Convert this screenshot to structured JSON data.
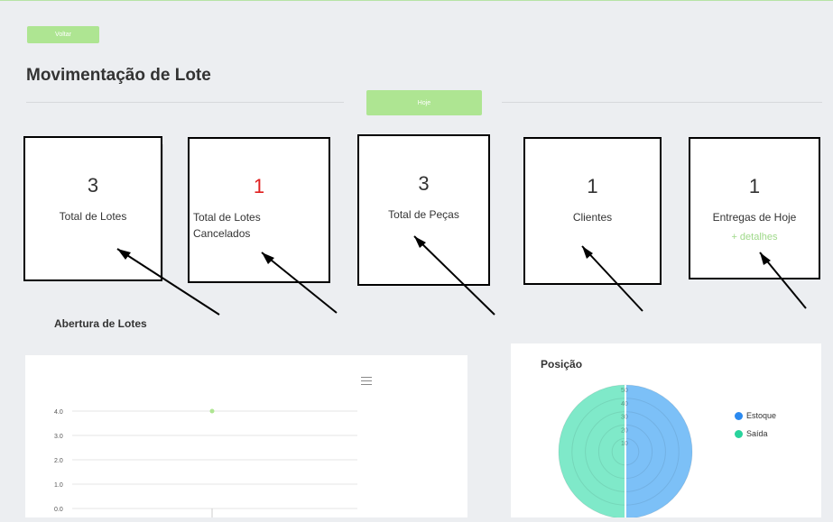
{
  "header": {
    "back_label": "Voltar",
    "title": "Movimentação de Lote",
    "today_label": "Hoje"
  },
  "cards": [
    {
      "value": "3",
      "label": "Total de Lotes"
    },
    {
      "value": "1",
      "label_line1": "Total de Lotes",
      "label_line2": "Cancelados",
      "value_color": "#e02020"
    },
    {
      "value": "3",
      "label": "Total de Peças"
    },
    {
      "value": "1",
      "label": "Clientes"
    },
    {
      "value": "1",
      "label": "Entregas de Hoje",
      "link": "+ detalhes"
    }
  ],
  "sections": {
    "lotes_title": "Abertura de Lotes"
  },
  "colors": {
    "accent_green": "#aee592",
    "estoque": "#7cc0f7",
    "saida": "#7fe9c9"
  },
  "chart_data": [
    {
      "type": "line",
      "title": "",
      "yticks": [
        "4.0",
        "3.0",
        "2.0",
        "1.0",
        "0.0"
      ],
      "ylim": [
        0,
        4
      ],
      "series": [
        {
          "values": [
            4
          ]
        }
      ],
      "grid": true,
      "menu_icon": "hamburger-icon"
    },
    {
      "type": "pie",
      "title": "Posição",
      "radial_ticks": [
        "50",
        "40",
        "30",
        "20",
        "10"
      ],
      "series": [
        {
          "name": "Estoque",
          "value": 50
        },
        {
          "name": "Saída",
          "value": 50
        }
      ],
      "legend": "right"
    }
  ]
}
